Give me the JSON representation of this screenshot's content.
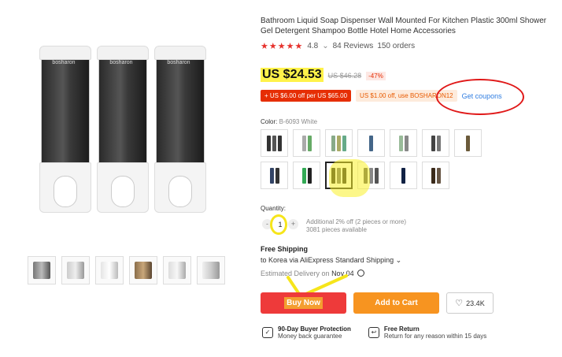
{
  "product": {
    "title": "Bathroom Liquid Soap Dispenser Wall Mounted For Kitchen Plastic 300ml Shower Gel Detergent Shampoo Bottle Hotel Home Accessories",
    "brand_on_bottle": "bosharon",
    "rating": "4.8",
    "reviews": "84 Reviews",
    "orders": "150 orders"
  },
  "price": {
    "current": "US $24.53",
    "original": "US $46.28",
    "discount": "-47%"
  },
  "coupons": {
    "store_coupon": "US $6.00 off per US $65.00",
    "code_coupon": "US $1.00 off, use BOSHARON12",
    "get_coupons": "Get coupons"
  },
  "color": {
    "label": "Color:",
    "value": "B-6093 White"
  },
  "quantity": {
    "label": "Quantity:",
    "value": "1",
    "minus": "-",
    "plus": "+",
    "note_line1": "Additional 2% off (2 pieces or more)",
    "note_line2": "3081 pieces available"
  },
  "shipping": {
    "title": "Free Shipping",
    "line": "to Korea via AliExpress Standard Shipping",
    "delivery_label": "Estimated Delivery on",
    "delivery_date": "Nov 04"
  },
  "actions": {
    "buy_now": "Buy Now",
    "add_to_cart": "Add to Cart",
    "wishlist_count": "23.4K"
  },
  "guarantees": [
    {
      "title": "90-Day Buyer Protection",
      "sub": "Money back guarantee"
    },
    {
      "title": "Free Return",
      "sub": "Return for any reason within 15 days"
    }
  ],
  "colors": {
    "accent_red": "#ee3a3a",
    "accent_orange": "#f79420",
    "star_red": "#e6312c",
    "link_blue": "#2f7de1",
    "highlight_yellow": "#f6e51b",
    "annotation_red": "#e01818"
  },
  "icons": [
    "star-icon",
    "chevron-down-icon",
    "clock-icon",
    "heart-icon",
    "shield-check-icon",
    "return-icon"
  ]
}
